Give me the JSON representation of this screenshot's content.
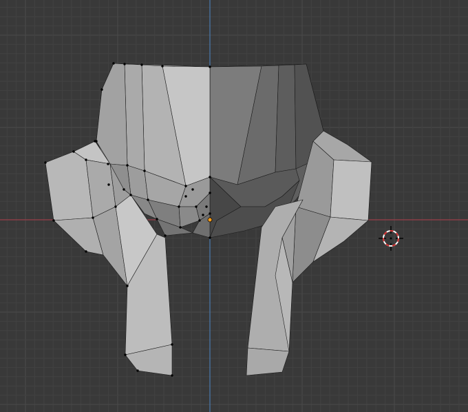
{
  "viewport": {
    "background": "#393939",
    "grid_minor_color": "#424242",
    "grid_major_color": "#4a4a4a",
    "x_axis_color": "#9a3f4a",
    "z_axis_color": "#4a7bb0"
  },
  "mesh": {
    "vertex_color": "#000000",
    "edge_color": "#1a1a1a",
    "origin_color": "#ff9e1a"
  },
  "cursor": {
    "icon": "3d-cursor-icon",
    "ring_color_a": "#d22d2d",
    "ring_color_b": "#ffffff"
  }
}
